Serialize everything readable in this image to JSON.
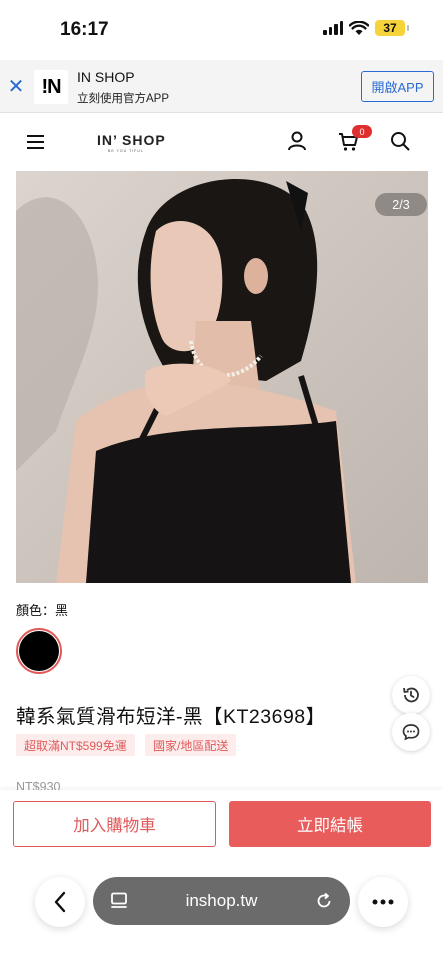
{
  "status_bar": {
    "time": "16:17",
    "battery": "37"
  },
  "app_banner": {
    "logo_text": "!N",
    "title": "IN SHOP",
    "subtitle": "立刻使用官方APP",
    "open_button": "開啟APP"
  },
  "header": {
    "brand": "IN’ SHOP",
    "brand_tagline": "BE YOU TIFUL",
    "cart_count": "0"
  },
  "product": {
    "image_counter": "2/3",
    "color_label": "顏色：黑",
    "color_swatch": "#000000",
    "title": "韓系氣質滑布短洋-黑【KT23698】",
    "tags": [
      "超取滿NT$599免運",
      "國家/地區配送"
    ],
    "price": "NT$930"
  },
  "actions": {
    "add_to_cart": "加入購物車",
    "buy_now": "立即結帳"
  },
  "browser": {
    "url": "inshop.tw"
  },
  "colors": {
    "accent": "#e85c5c",
    "banner_blue": "#2a6bd3"
  }
}
